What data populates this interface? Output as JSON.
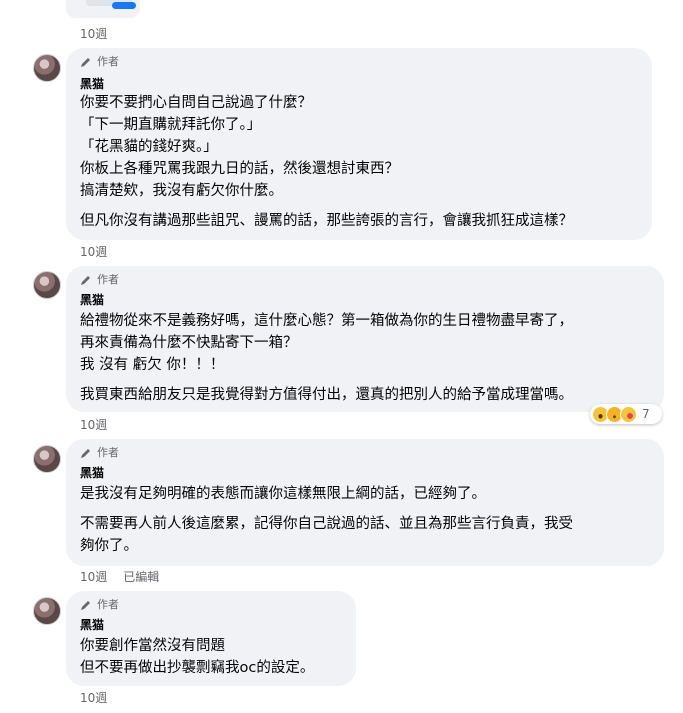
{
  "top": {
    "timestamp": "10週"
  },
  "comments": [
    {
      "badge": "作者",
      "author": "黑猫",
      "lines": [
        "你要不要捫心自問自己說過了什麼？",
        "「下一期直購就拜託你了。」",
        "「花黑貓的錢好爽。」",
        "你板上各種咒罵我跟九日的話，然後還想討東西？",
        "搞清楚欸，我沒有虧欠你什麼。",
        "但凡你沒有講過那些詛咒、謾罵的話，那些誇張的言行，會讓我抓狂成這樣？"
      ],
      "timestamp": "10週"
    },
    {
      "badge": "作者",
      "author": "黑猫",
      "lines": [
        "給禮物從來不是義務好嗎，這什麼心態？第一箱做為你的生日禮物盡早寄了，",
        "再來責備為什麼不快點寄下一箱？",
        "我 沒有 虧欠 你！！！",
        "我買東西給朋友只是我覺得對方值得付出，還真的把別人的給予當成理當嗎。"
      ],
      "timestamp": "10週",
      "reactions": {
        "icons": [
          "wow-icon",
          "sad-icon",
          "care-icon"
        ],
        "count": "7"
      }
    },
    {
      "badge": "作者",
      "author": "黑猫",
      "lines": [
        "是我沒有足夠明確的表態而讓你這樣無限上綱的話，已經夠了。",
        "不需要再人前人後這麼累，記得你自己說過的話、並且為那些言行負責，我受",
        "夠你了。"
      ],
      "timestamp": "10週",
      "edited": "已編輯"
    },
    {
      "badge": "作者",
      "author": "黑猫",
      "lines": [
        "你要創作當然沒有問題",
        "但不要再做出抄襲剽竊我oc的設定。"
      ],
      "timestamp": "10週"
    }
  ]
}
